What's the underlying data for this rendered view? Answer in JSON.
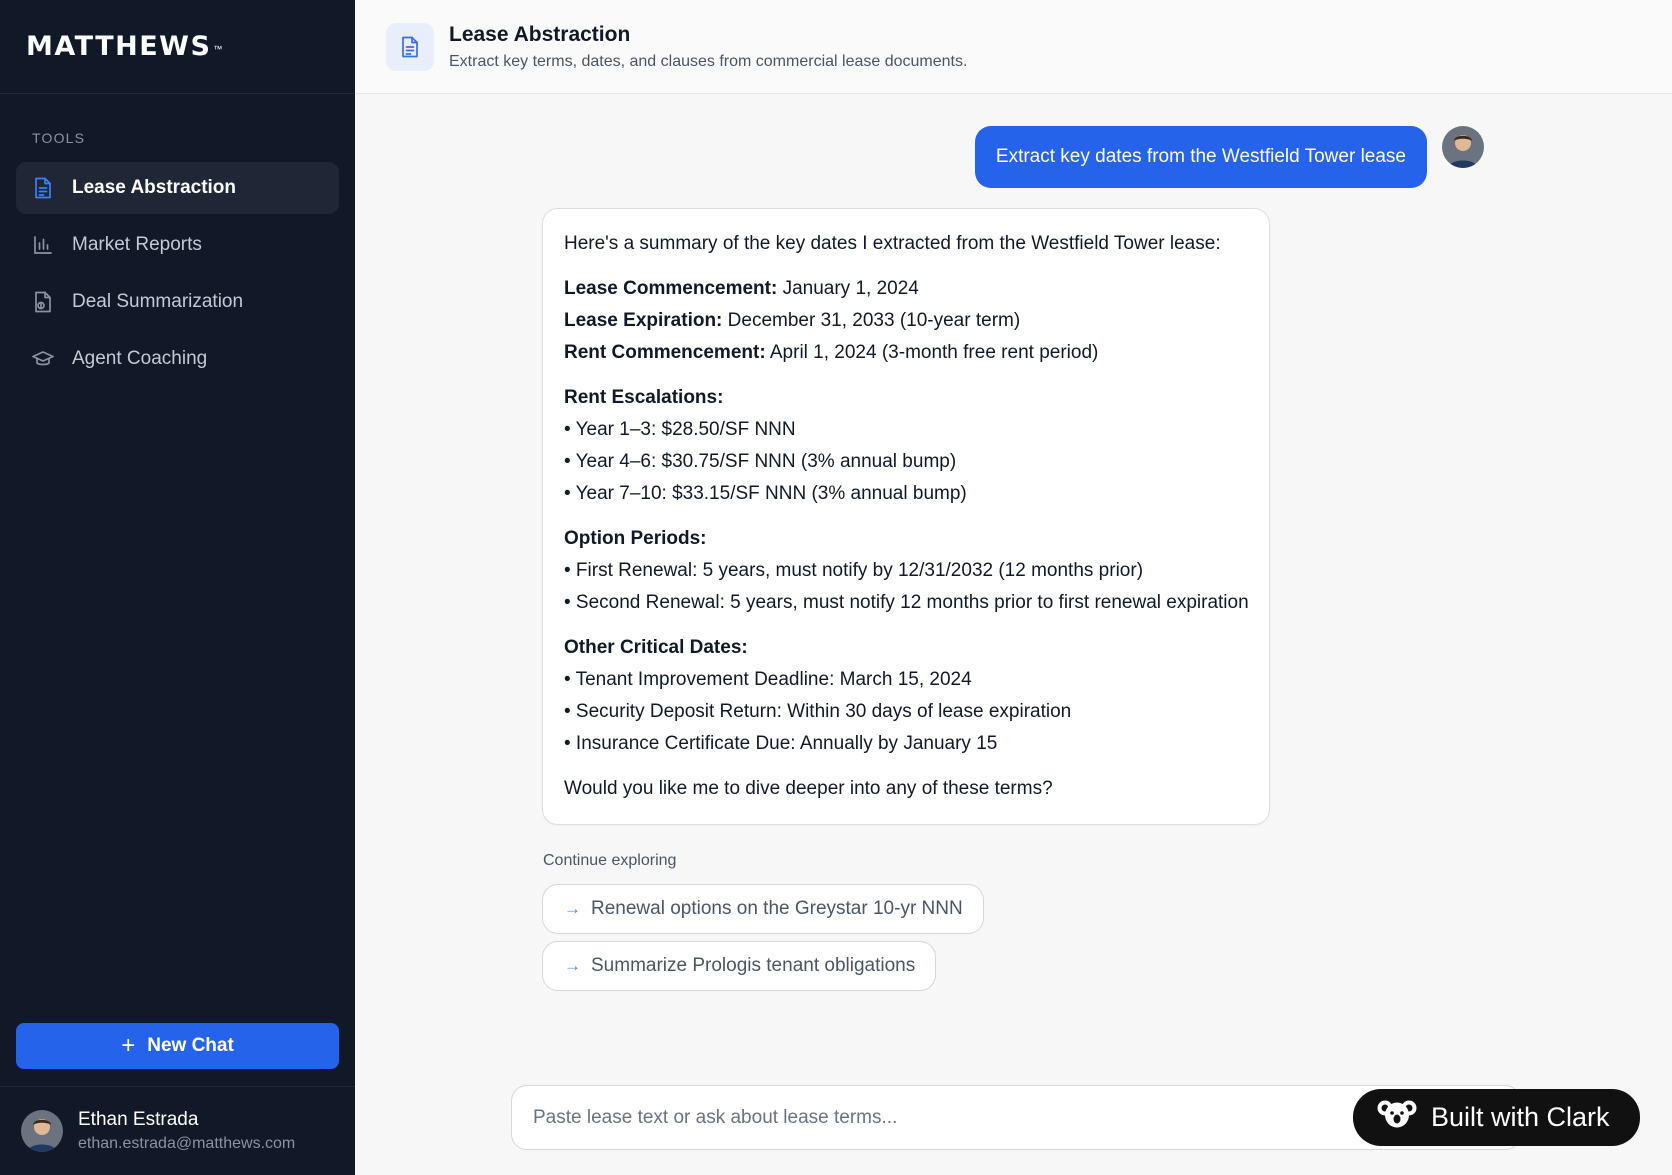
{
  "brand": {
    "name": "MATTHEWS",
    "tm": "™"
  },
  "sidebar": {
    "section_label": "TOOLS",
    "items": [
      {
        "label": "Lease Abstraction",
        "icon": "document-icon",
        "active": true
      },
      {
        "label": "Market Reports",
        "icon": "bar-chart-icon",
        "active": false
      },
      {
        "label": "Deal Summarization",
        "icon": "document-dollar-icon",
        "active": false
      },
      {
        "label": "Agent Coaching",
        "icon": "graduation-cap-icon",
        "active": false
      }
    ],
    "new_chat_label": "New Chat"
  },
  "user": {
    "name": "Ethan Estrada",
    "email": "ethan.estrada@matthews.com"
  },
  "header": {
    "title": "Lease Abstraction",
    "subtitle": "Extract key terms, dates, and clauses from commercial lease documents."
  },
  "chat": {
    "user_message": "Extract key dates from the Westfield Tower lease",
    "assistant": {
      "intro": "Here's a summary of the key dates I extracted from the Westfield Tower lease:",
      "dates": [
        {
          "label": "Lease Commencement:",
          "value": " January 1, 2024"
        },
        {
          "label": "Lease Expiration:",
          "value": " December 31, 2033 (10-year term)"
        },
        {
          "label": "Rent Commencement:",
          "value": " April 1, 2024 (3-month free rent period)"
        }
      ],
      "rent_heading": "Rent Escalations:",
      "rent_items": [
        "• Year 1–3: $28.50/SF NNN",
        "• Year 4–6: $30.75/SF NNN (3% annual bump)",
        "• Year 7–10: $33.15/SF NNN (3% annual bump)"
      ],
      "option_heading": "Option Periods:",
      "option_items": [
        "• First Renewal: 5 years, must notify by 12/31/2032 (12 months prior)",
        "• Second Renewal: 5 years, must notify 12 months prior to first renewal expiration"
      ],
      "other_heading": "Other Critical Dates:",
      "other_items": [
        "• Tenant Improvement Deadline: March 15, 2024",
        "• Security Deposit Return: Within 30 days of lease expiration",
        "• Insurance Certificate Due: Annually by January 15"
      ],
      "closing": "Would you like me to dive deeper into any of these terms?"
    }
  },
  "continue": {
    "label": "Continue exploring",
    "suggestions": [
      "Renewal options on the Greystar 10-yr NNN",
      "Summarize Prologis tenant obligations"
    ]
  },
  "input": {
    "placeholder": "Paste lease text or ask about lease terms..."
  },
  "badge": {
    "label": "Built with Clark"
  },
  "colors": {
    "accent": "#2563eb",
    "sidebar_bg": "#111827",
    "active_item_bg": "#1f2737"
  }
}
